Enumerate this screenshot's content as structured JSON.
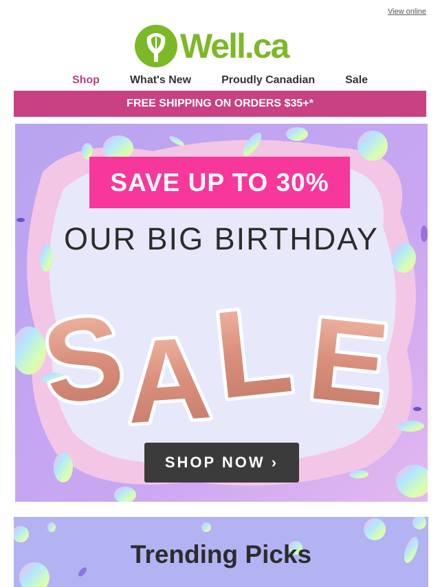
{
  "header": {
    "view_online": "View online",
    "logo_text": "Well.ca"
  },
  "nav": {
    "items": [
      {
        "label": "Shop",
        "active": true
      },
      {
        "label": "What's New"
      },
      {
        "label": "Proudly Canadian"
      },
      {
        "label": "Sale"
      }
    ]
  },
  "shipping_banner": "FREE SHIPPING ON ORDERS $35+*",
  "hero": {
    "badge": "SAVE UP TO 30%",
    "headline": "OUR BIG BIRTHDAY",
    "balloon_text": "SALE",
    "cta": "SHOP NOW ›"
  },
  "trending": {
    "title": "Trending Picks"
  },
  "colors": {
    "brand_green": "#7cb928",
    "brand_pink": "#c94183",
    "badge_pink": "#f7379a",
    "hero_purple": "#c6a0f0",
    "cta_dark": "#3b3b3b"
  }
}
